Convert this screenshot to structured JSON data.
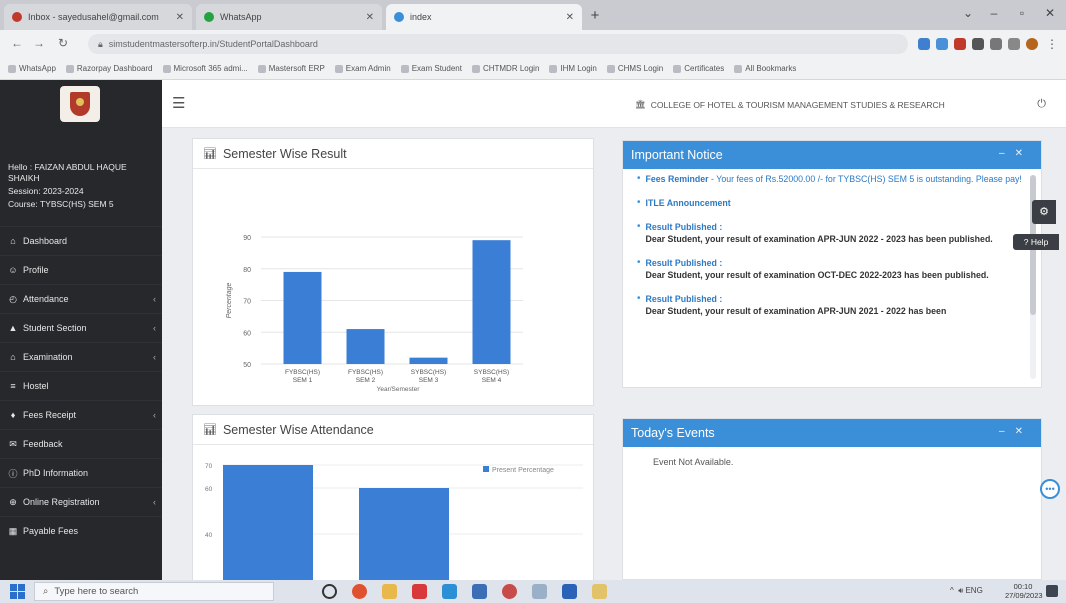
{
  "browser": {
    "tabs": [
      {
        "title": "Inbox - sayedusahel@gmail.com",
        "color": "#c0392b"
      },
      {
        "title": "WhatsApp",
        "color": "#25a244"
      },
      {
        "title": "index",
        "color": "#3a8fd8"
      }
    ],
    "url": "simstudentmastersofterp.in/StudentPortalDashboard",
    "bookmarks": [
      "WhatsApp",
      "Razorpay Dashboard",
      "Microsoft 365 admi...",
      "Mastersoft ERP",
      "Exam Admin",
      "Exam Student",
      "CHTMDR Login",
      "IHM Login",
      "CHMS Login",
      "Certificates",
      "All Bookmarks"
    ]
  },
  "sidebar": {
    "user_hello": "Hello : FAIZAN ABDUL HAQUE SHAIKH",
    "session": "Session: 2023-2024",
    "course": "Course: TYBSC(HS) SEM 5",
    "items": [
      {
        "label": "Dashboard",
        "icon": "home-icon",
        "glyph": "⌂",
        "chevron": false
      },
      {
        "label": "Profile",
        "icon": "user-icon",
        "glyph": "☺",
        "chevron": false
      },
      {
        "label": "Attendance",
        "icon": "clock-icon",
        "glyph": "◴",
        "chevron": true
      },
      {
        "label": "Student Section",
        "icon": "student-icon",
        "glyph": "▲",
        "chevron": true
      },
      {
        "label": "Examination",
        "icon": "institution-icon",
        "glyph": "⌂",
        "chevron": true
      },
      {
        "label": "Hostel",
        "icon": "bed-icon",
        "glyph": "≡",
        "chevron": false
      },
      {
        "label": "Fees Receipt",
        "icon": "receipt-icon",
        "glyph": "♦",
        "chevron": true
      },
      {
        "label": "Feedback",
        "icon": "feedback-icon",
        "glyph": "✉",
        "chevron": false
      },
      {
        "label": "PhD Information",
        "icon": "info-icon",
        "glyph": "ⓘ",
        "chevron": false
      },
      {
        "label": "Online Registration",
        "icon": "registration-icon",
        "glyph": "⊕",
        "chevron": true
      },
      {
        "label": "Payable Fees",
        "icon": "payment-icon",
        "glyph": "▦",
        "chevron": false
      }
    ]
  },
  "topbar": {
    "college": "COLLEGE OF HOTEL & TOURISM MANAGEMENT STUDIES & RESEARCH"
  },
  "result_panel": {
    "title": "Semester Wise Result"
  },
  "attendance_panel": {
    "title": "Semester Wise Attendance"
  },
  "chart_data": [
    {
      "type": "bar",
      "title": "Semester Wise Result",
      "categories": [
        "FYBSC(HS) SEM 1",
        "FYBSC(HS) SEM 2",
        "SYBSC(HS) SEM 3",
        "SYBSC(HS) SEM 4"
      ],
      "values": [
        79,
        61,
        52,
        89
      ],
      "xlabel": "Year/Semester",
      "ylabel": "Percentage",
      "ylim": [
        50,
        90
      ],
      "yticks": [
        50,
        60,
        70,
        80,
        90
      ],
      "color": "#3a7fd5"
    },
    {
      "type": "bar",
      "title": "Semester Wise Attendance",
      "series": [
        {
          "name": "Present Percentage",
          "values": [
            70,
            60
          ]
        }
      ],
      "yticks": [
        40,
        60,
        70
      ],
      "ylim": [
        20,
        70
      ],
      "legend": "top-right",
      "color": "#3a7fd5"
    }
  ],
  "notice": {
    "title": "Important Notice",
    "items": [
      {
        "title": "Fees Reminder",
        "sep": " - ",
        "text": "Your fees of Rs.52000.00 /- for TYBSC(HS) SEM 5 is outstanding. Please pay!",
        "bold_text": false
      },
      {
        "title": "ITLE Announcement",
        "sep": "",
        "text": "",
        "bold_text": false
      },
      {
        "title": "Result Published :",
        "sep": "",
        "text": "Dear Student, your result of examination APR-JUN 2022 - 2023 has been published.",
        "bold_text": true
      },
      {
        "title": "Result Published :",
        "sep": "",
        "text": "Dear Student, your result of examination OCT-DEC 2022-2023 has been published.",
        "bold_text": true
      },
      {
        "title": "Result Published :",
        "sep": "",
        "text": "Dear Student, your result of examination APR-JUN 2021 - 2022 has been",
        "bold_text": true
      }
    ]
  },
  "events": {
    "title": "Today's Events",
    "empty_text": "Event Not Available."
  },
  "floating": {
    "help_label": "Help"
  },
  "taskbar": {
    "search_placeholder": "Type here to search",
    "lang": "ENG",
    "time": "00:10",
    "date": "27/09/2023"
  }
}
